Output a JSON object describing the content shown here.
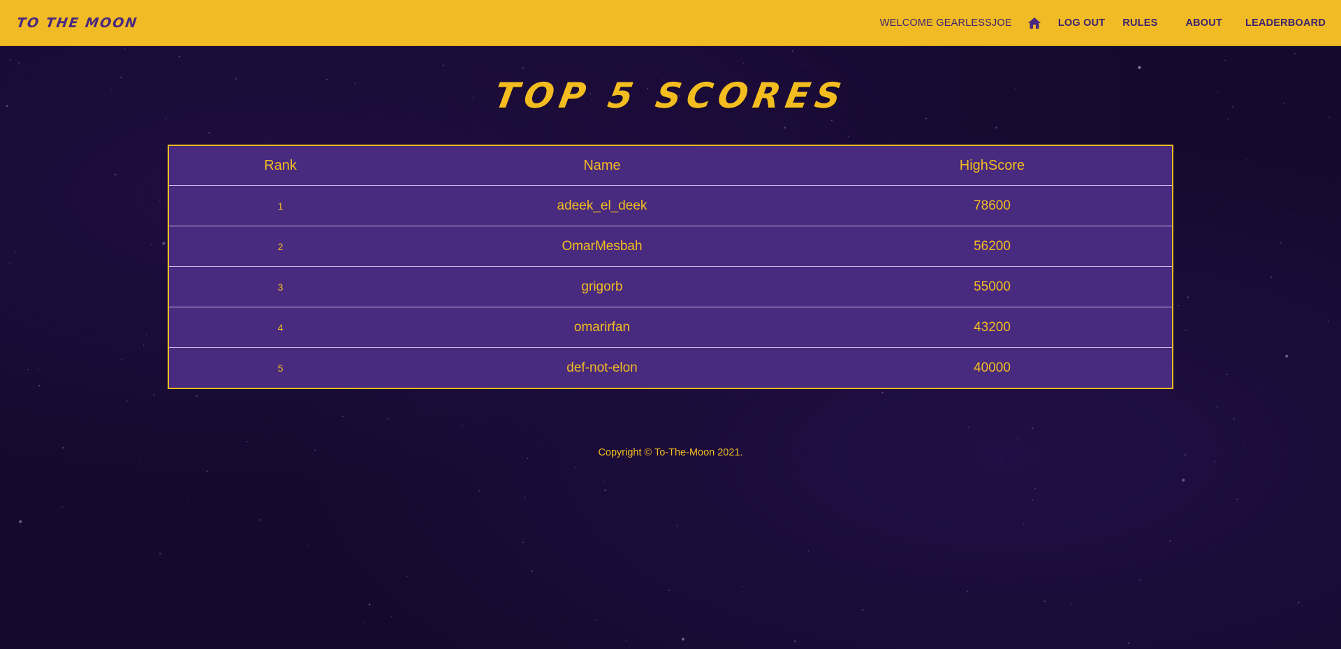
{
  "navbar": {
    "brand": "TO THE MOON",
    "welcome": "WELCOME GEARLESSJOE",
    "home_icon": "home-icon",
    "logout": "LOG OUT",
    "rules": "RULES",
    "about": "ABOUT",
    "leaderboard": "LEADERBOARD"
  },
  "page": {
    "title": "TOP 5 SCORES"
  },
  "table": {
    "headers": {
      "rank": "Rank",
      "name": "Name",
      "score": "HighScore"
    },
    "rows": [
      {
        "rank": "1",
        "name": "adeek_el_deek",
        "score": "78600"
      },
      {
        "rank": "2",
        "name": "OmarMesbah",
        "score": "56200"
      },
      {
        "rank": "3",
        "name": "grigorb",
        "score": "55000"
      },
      {
        "rank": "4",
        "name": "omarirfan",
        "score": "43200"
      },
      {
        "rank": "5",
        "name": "def-not-elon",
        "score": "40000"
      }
    ]
  },
  "footer": {
    "copyright": "Copyright © To-The-Moon 2021."
  },
  "colors": {
    "navbar": "#f0bb24",
    "accent": "#f3bd20",
    "table_bg": "#482a7e",
    "background": "#150a2e",
    "nav_text": "#3c2270"
  }
}
